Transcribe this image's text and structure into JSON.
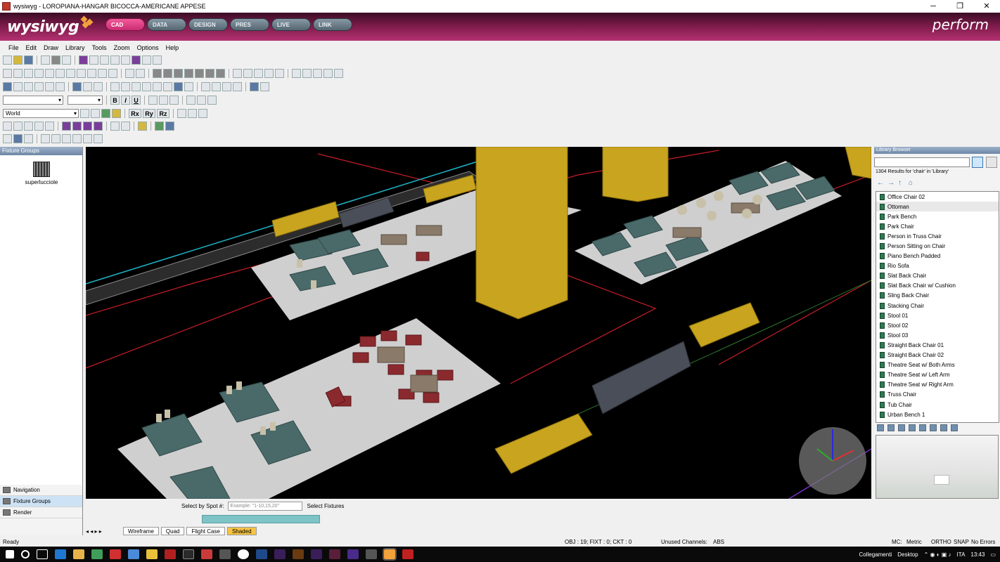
{
  "window": {
    "title": "wysiwyg - LOROPIANA-HANGAR BICOCCA-AMERICANE APPESE",
    "minimize": "─",
    "maximize": "❐",
    "close": "✕"
  },
  "banner": {
    "logo": "wysiwyg",
    "mode": "perform",
    "tabs": [
      "CAD",
      "DATA",
      "DESIGN",
      "PRES",
      "LIVE",
      "LINK"
    ],
    "active_tab": "CAD"
  },
  "menu": [
    "File",
    "Edit",
    "Draw",
    "Library",
    "Tools",
    "Zoom",
    "Options",
    "Help"
  ],
  "text_toolbar": {
    "bold": "B",
    "italic": "I",
    "underline": "U",
    "rx": "Rx",
    "ry": "Ry",
    "rz": "Rz"
  },
  "layer_select": "World",
  "fixture_groups": {
    "header": "Fixture Groups",
    "item": "superlucciole"
  },
  "side_nav": [
    "Navigation",
    "Fixture Groups",
    "Render"
  ],
  "library": {
    "header": "Library Browser",
    "results": "1304 Results for 'chair' in 'Library'",
    "items": [
      "Office Chair 02",
      "Ottoman",
      "Park Bench",
      "Park Chair",
      "Person in Truss Chair",
      "Person Sitting on Chair",
      "Piano Bench Padded",
      "Rio Sofa",
      "Slat Back Chair",
      "Slat Back Chair w/ Cushion",
      "Sling Back Chair",
      "Stacking Chair",
      "Stool 01",
      "Stool 02",
      "Stool 03",
      "Straight Back Chair 01",
      "Straight Back Chair 02",
      "Theatre Seat w/ Both Arms",
      "Theatre Seat w/ Left Arm",
      "Theatre Seat w/ Right Arm",
      "Truss Chair",
      "Tub Chair",
      "Urban Bench 1"
    ],
    "selected": "Ottoman"
  },
  "spot_bar": {
    "label": "Select by Spot #:",
    "placeholder": "Example: \"1-10,15,20\"",
    "fixtures": "Select Fixtures"
  },
  "view_tabs": [
    "Wireframe",
    "Quad",
    "Flight Case",
    "Shaded"
  ],
  "active_view": "Shaded",
  "status": {
    "ready": "Ready",
    "counts": "OBJ : 19; FIXT : 0; CKT : 0",
    "channels": "Unused Channels:",
    "abs": "ABS",
    "mc": "MC:",
    "metric": "Metric",
    "ortho": "ORTHO",
    "snap": "SNAP",
    "errors": "No Errors"
  },
  "taskbar": {
    "links": "Collegamenti",
    "desktop": "Desktop",
    "lang": "ITA",
    "time": "13:43"
  },
  "colors": {
    "table_top": "#4a6a6a",
    "chair": "#c8c0a8",
    "floor": "#cfcfcf",
    "column": "#c9a41e",
    "truss_cyan": "#1fb6c9",
    "red_lines": "#d0202a",
    "sofa_red": "#8b2a2e",
    "box_grey": "#4a4e58"
  }
}
